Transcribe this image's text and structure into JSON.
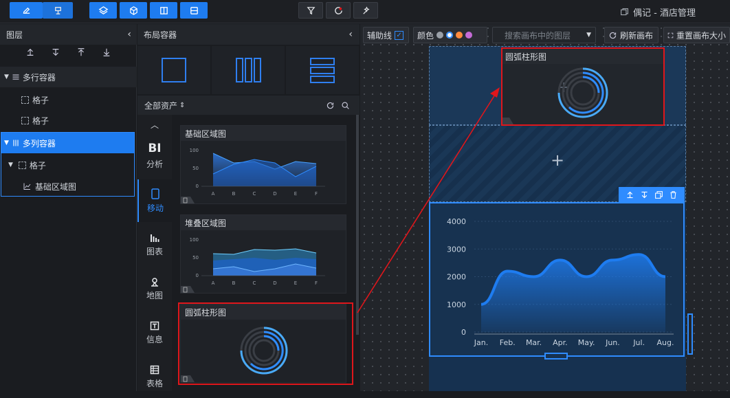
{
  "header": {
    "app_title": "偶记 - 酒店管理"
  },
  "layer_panel": {
    "title": "图层",
    "tree": [
      {
        "label": "多行容器"
      },
      {
        "label": "格子"
      },
      {
        "label": "格子"
      },
      {
        "label": "多列容器"
      },
      {
        "label": "格子"
      },
      {
        "label": "基础区域图"
      }
    ]
  },
  "layout_panel": {
    "title": "布局容器",
    "asset_filter": "全部资产",
    "nav": [
      {
        "label": "BI",
        "sub": "分析"
      },
      {
        "label": "移动"
      },
      {
        "label": "图表"
      },
      {
        "label": "地图"
      },
      {
        "label": "信息"
      },
      {
        "label": "表格"
      }
    ],
    "cards": [
      {
        "title": "基础区域图"
      },
      {
        "title": "堆叠区域图"
      },
      {
        "title": "圆弧柱形图"
      }
    ],
    "thumb_axis": {
      "y": [
        "100",
        "50",
        "0"
      ],
      "x": [
        "A",
        "B",
        "C",
        "D",
        "E",
        "F"
      ]
    }
  },
  "canvas_toolbar": {
    "guides_label": "辅助线",
    "color_label": "颜色",
    "search_placeholder": "搜索画布中的图层",
    "refresh_label": "刷新画布",
    "reset_label": "重置画布大小"
  },
  "colors": {
    "accent": "#1e7cf0",
    "swatches": [
      "#9aa0a8",
      "#ffffff",
      "#ff8a3d",
      "#c56bd6"
    ],
    "highlight": "#e0161b"
  },
  "canvas": {
    "drop_title": "圆弧柱形图",
    "chart_data": {
      "type": "area",
      "categories": [
        "Jan.",
        "Feb.",
        "Mar.",
        "Apr.",
        "May.",
        "Jun.",
        "Jul.",
        "Aug."
      ],
      "values": [
        1000,
        2200,
        2000,
        2600,
        2000,
        2600,
        2800,
        2000
      ],
      "yticks": [
        "4000",
        "3000",
        "2000",
        "1000",
        "0"
      ],
      "ylim": [
        0,
        4000
      ]
    }
  }
}
